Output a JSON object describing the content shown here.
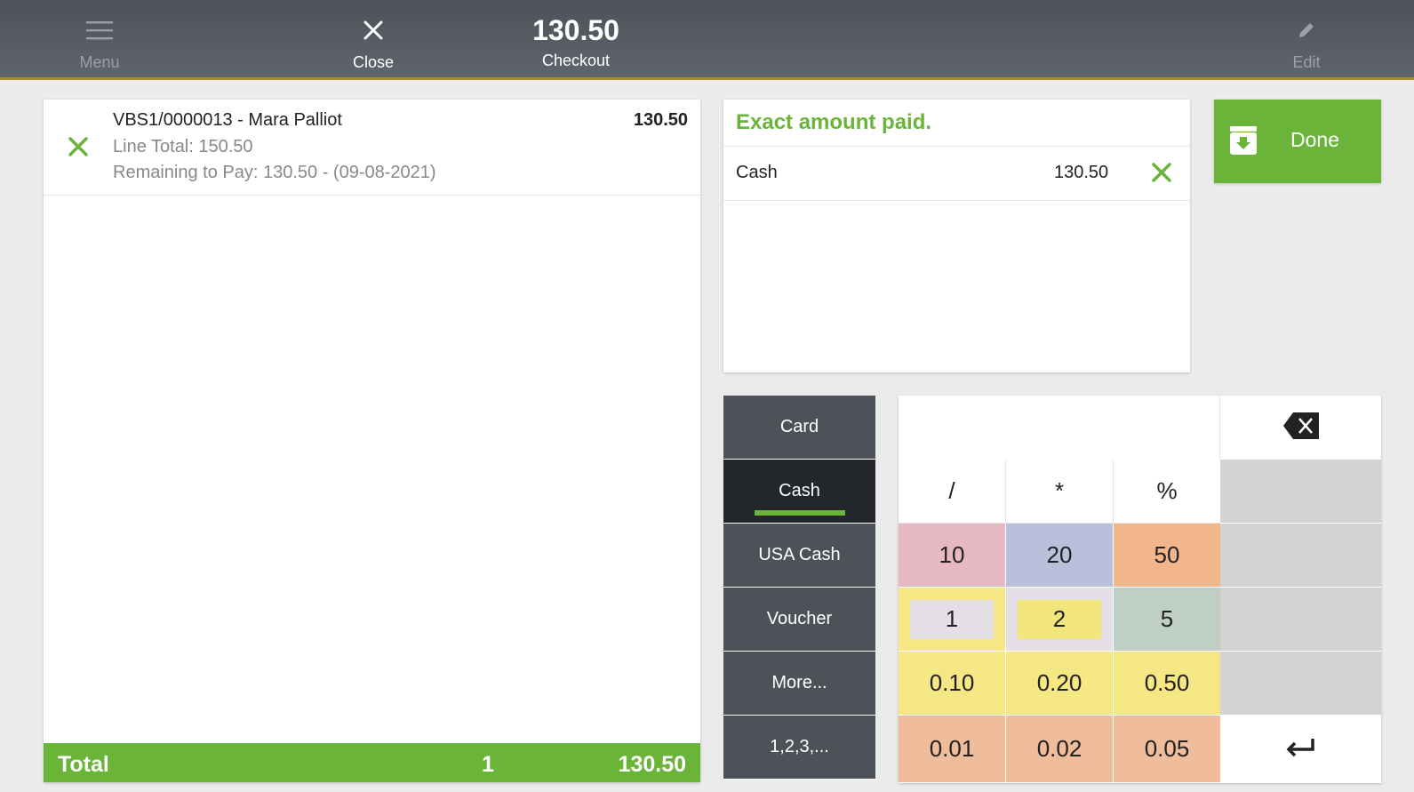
{
  "topbar": {
    "menu_label": "Menu",
    "close_label": "Close",
    "amount": "130.50",
    "checkout_label": "Checkout",
    "edit_label": "Edit"
  },
  "ticket": {
    "line": {
      "title": "VBS1/0000013 - Mara Palliot",
      "line_total": "Line Total: 150.50",
      "remaining": "Remaining to Pay: 130.50 - (09-08-2021)",
      "amount": "130.50"
    },
    "total": {
      "label": "Total",
      "count": "1",
      "amount": "130.50"
    }
  },
  "payments": {
    "status": "Exact amount paid.",
    "rows": [
      {
        "name": "Cash",
        "amount": "130.50"
      }
    ]
  },
  "done": {
    "label": "Done"
  },
  "methods": [
    "Card",
    "Cash",
    "USA Cash",
    "Voucher",
    "More...",
    "1,2,3,..."
  ],
  "selected_method": "Cash",
  "keypad": {
    "operators": [
      "/",
      "*",
      "%"
    ],
    "rows": [
      [
        "10",
        "20",
        "50"
      ],
      [
        "1",
        "2",
        "5"
      ],
      [
        "0.10",
        "0.20",
        "0.50"
      ],
      [
        "0.01",
        "0.02",
        "0.05"
      ]
    ]
  },
  "colors": {
    "accent_green": "#6ab43a",
    "topbar": "#555a61",
    "key_10": "#e6b8c4",
    "key_20": "#b8c0dc",
    "key_50": "#f2b68d",
    "key_1_chip": "#e3dfe5",
    "key_2_chip": "#f3e57e",
    "key_5": "#bfcfc6",
    "key_yellow": "#f5e784",
    "key_peach": "#efbd9c"
  }
}
